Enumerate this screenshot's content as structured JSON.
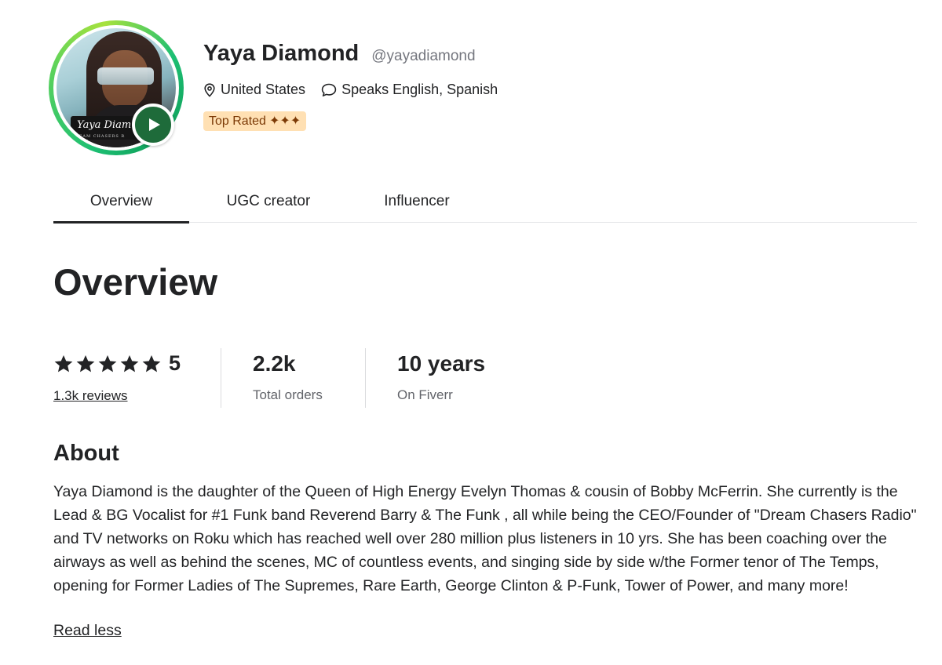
{
  "profile": {
    "name": "Yaya Diamond",
    "handle": "@yayadiamond",
    "location": "United States",
    "languages": "Speaks English, Spanish",
    "badge": "Top Rated",
    "badge_marks": "✦✦✦",
    "avatar_banner_text": "Yaya Diam",
    "avatar_banner_subtext": "REAM CHASERS R",
    "ring_color": "#1dbf73",
    "play_button_color": "#1e6b3a",
    "badge_bg": "#ffe0b3",
    "badge_text_color": "#7c3a06"
  },
  "tabs": [
    {
      "label": "Overview",
      "active": true
    },
    {
      "label": "UGC creator",
      "active": false
    },
    {
      "label": "Influencer",
      "active": false
    }
  ],
  "overview": {
    "title": "Overview",
    "rating": "5",
    "stars": 5,
    "reviews_link": "1.3k reviews",
    "orders_value": "2.2k",
    "orders_label": "Total orders",
    "tenure_value": "10 years",
    "tenure_label": "On Fiverr"
  },
  "about": {
    "title": "About",
    "text": "Yaya Diamond is the daughter of the Queen of High Energy Evelyn Thomas & cousin of Bobby McFerrin. She currently is the Lead & BG Vocalist for #1 Funk band Reverend Barry & The Funk , all while being the CEO/Founder of \"Dream Chasers Radio\" and TV networks on Roku which has reached well over 280 million plus listeners in 10 yrs. She has been coaching over the airways as well as behind the scenes, MC of countless events, and singing side by side w/the Former tenor of The Temps, opening for Former Ladies of The Supremes, Rare Earth, George Clinton & P-Funk, Tower of Power, and many more!",
    "read_less": "Read less"
  },
  "icons": {
    "location": "location-pin-icon",
    "languages": "speech-bubble-icon",
    "play": "play-icon",
    "star": "star-icon"
  }
}
